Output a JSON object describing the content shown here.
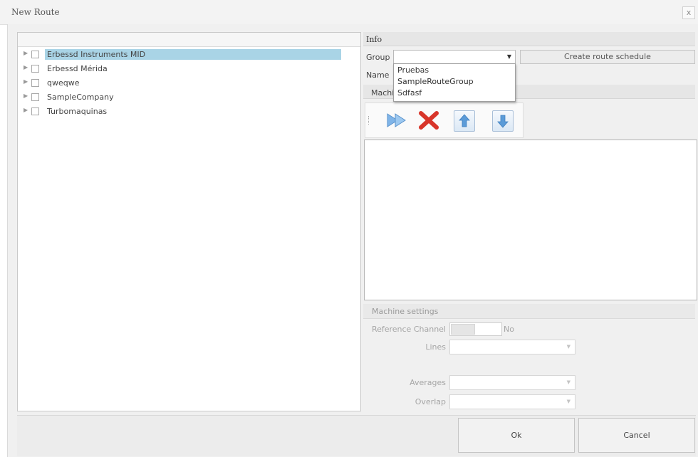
{
  "window": {
    "title": "New Route",
    "close_glyph": "x"
  },
  "tree": {
    "items": [
      {
        "label": "Erbessd Instruments MID",
        "selected": true
      },
      {
        "label": "Erbessd Mérida",
        "selected": false
      },
      {
        "label": "qweqwe",
        "selected": false
      },
      {
        "label": "SampleCompany",
        "selected": false
      },
      {
        "label": "Turbomaquinas",
        "selected": false
      }
    ]
  },
  "info": {
    "header": "Info",
    "group_label": "Group",
    "group_value": "",
    "create_schedule_label": "Create route schedule",
    "name_label": "Name",
    "dropdown_options": [
      "Pruebas",
      "SampleRouteGroup",
      "Sdfasf"
    ],
    "machines_label": "Machi"
  },
  "toolbar": {
    "icons": [
      "add-arrow-icon",
      "delete-x-icon",
      "move-up-icon",
      "move-down-icon"
    ]
  },
  "machine_settings": {
    "header": "Machine settings",
    "reference_channel_label": "Reference Channel",
    "reference_channel_value": "No",
    "lines_label": "Lines",
    "averages_label": "Averages",
    "overlap_label": "Overlap"
  },
  "buttons": {
    "ok": "Ok",
    "cancel": "Cancel"
  }
}
